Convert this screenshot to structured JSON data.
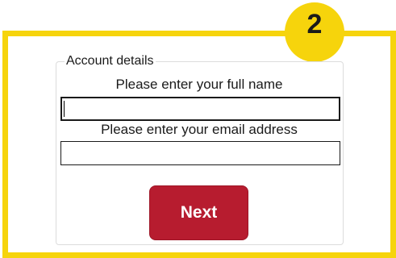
{
  "step": {
    "number": "2"
  },
  "form": {
    "legend": "Account details",
    "name_label": "Please enter your full name",
    "name_value": "",
    "email_label": "Please enter your email address",
    "email_value": "",
    "next_label": "Next"
  },
  "colors": {
    "accent_yellow": "#f6d40c",
    "button_red": "#b71c2f"
  }
}
